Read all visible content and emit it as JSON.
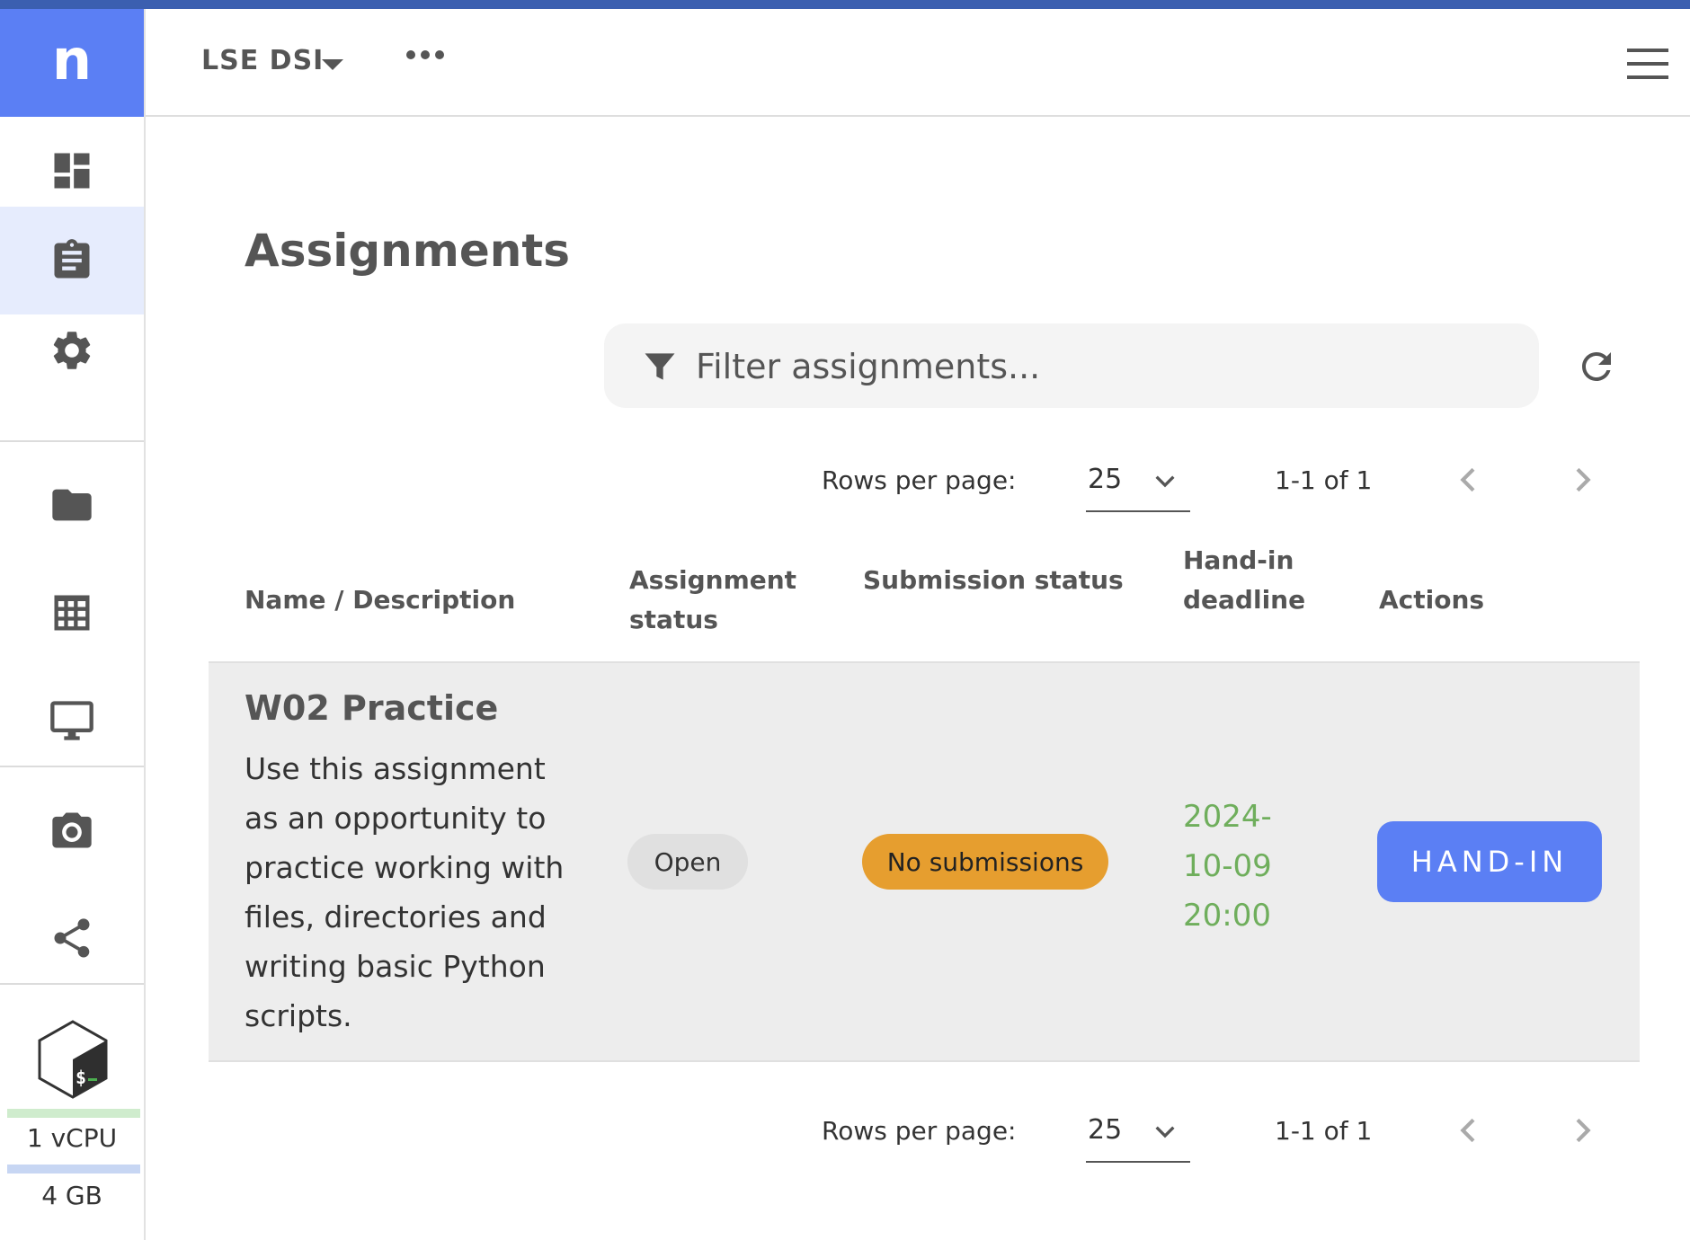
{
  "app": {
    "logo_glyph": "n",
    "org_name": "LSE DSI",
    "accent": "#5b7ff4"
  },
  "sidebar": {
    "items": [
      {
        "icon": "dashboard-icon"
      },
      {
        "icon": "assignment-icon",
        "active": true
      },
      {
        "icon": "settings-icon"
      },
      {
        "icon": "folder-icon"
      },
      {
        "icon": "table-icon"
      },
      {
        "icon": "monitor-icon"
      },
      {
        "icon": "camera-icon"
      },
      {
        "icon": "share-icon"
      }
    ],
    "resources": {
      "cpu_label": "1 vCPU",
      "mem_label": "4 GB",
      "cpu_bar_color": "#cfeccd",
      "mem_bar_color": "#c7d6f3"
    }
  },
  "main": {
    "title": "Assignments",
    "filter": {
      "placeholder": "Filter assignments..."
    },
    "pager": {
      "rows_per_page_label": "Rows per page:",
      "rows_per_page": "25",
      "range": "1-1 of 1"
    },
    "table": {
      "headers": {
        "name": "Name / Description",
        "assignment_status": "Assignment status",
        "submission_status": "Submission status",
        "deadline": "Hand-in deadline",
        "actions": "Actions"
      },
      "rows": [
        {
          "name": "W02 Practice",
          "description": "Use this assignment as an opportunity to practice working with files, directories and writing basic Python scripts.",
          "assignment_status": "Open",
          "submission_status": "No submissions",
          "deadline": "2024-10-09 20:00",
          "action": "HAND-IN"
        }
      ]
    }
  },
  "colors": {
    "submission_badge": "#e69e2f",
    "deadline_text": "#6fae5c",
    "row_background": "#ededed"
  }
}
